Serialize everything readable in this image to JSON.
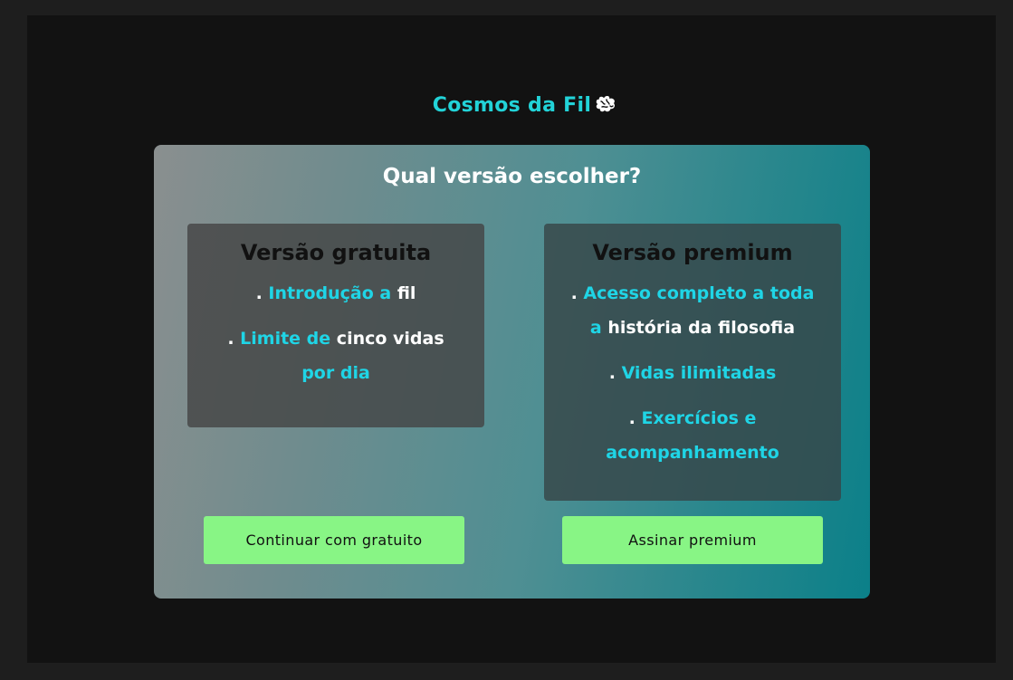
{
  "brand": {
    "title": "Cosmos da Fil",
    "icon": "brain-icon"
  },
  "panel": {
    "title": "Qual versão escolher?"
  },
  "free_card": {
    "heading": "Versão gratuita",
    "features": [
      {
        "bullet": ". ",
        "highlight": "Introdução a",
        "rest": " fil"
      },
      {
        "bullet": ". ",
        "highlight": "Limite de",
        "rest": " cinco vidas ",
        "highlight2": "por dia"
      }
    ]
  },
  "premium_card": {
    "heading": "Versão premium",
    "features": [
      {
        "bullet": ". ",
        "highlight": "Acesso completo a toda a",
        "rest": " história da filosofia"
      },
      {
        "bullet": ". ",
        "highlight": "Vidas ilimitadas",
        "rest": ""
      },
      {
        "bullet": ". ",
        "highlight": "Exercícios e acompanhamento",
        "rest": ""
      }
    ]
  },
  "buttons": {
    "free_label": "Continuar com gratuito",
    "premium_label": "Assinar premium"
  },
  "colors": {
    "page_bg": "#1e1e1e",
    "screen_bg": "#121212",
    "accent_cyan": "#22d3d8",
    "highlight": "#1fd5e6",
    "button_green": "#88f585",
    "gradient_start": "#8a8f8f",
    "gradient_end": "#0b8089"
  }
}
